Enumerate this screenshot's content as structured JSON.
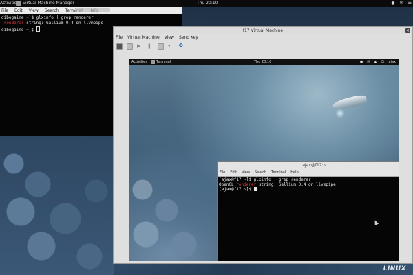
{
  "host": {
    "topbar": {
      "activities": "Activities",
      "app_name": "Virtual Machine Manager",
      "clock": "Thu 20:10",
      "tray": [
        "●",
        "✉",
        "☰"
      ]
    },
    "terminal": {
      "menu": [
        "File",
        "Edit",
        "View",
        "Search",
        "Terminal",
        "Help"
      ],
      "lines": [
        {
          "pre": "dibogaine ~]$ glxinfo | grep renderer",
          "hi": "",
          "post": ""
        },
        {
          "pre": "",
          "hi": " renderer",
          "post": " string: Gallium 0.4 on llvmpipe"
        },
        {
          "pre": "dibogaine ~]$ ",
          "hi": "",
          "post": ""
        }
      ]
    }
  },
  "vm_window": {
    "title": "f17 Virtual Machine",
    "close": "×",
    "menu": [
      "File",
      "Virtual Machine",
      "View",
      "Send Key"
    ]
  },
  "guest": {
    "topbar": {
      "activities": "Activities",
      "app_name": "Terminal",
      "clock": "Thu 20:10",
      "tray": [
        "●",
        "✉",
        "▲",
        "☺",
        "ajax"
      ]
    },
    "terminal": {
      "title": "ajax@f17:~",
      "close": "×",
      "menu": [
        "File",
        "Edit",
        "View",
        "Search",
        "Terminal",
        "Help"
      ],
      "lines": [
        {
          "pre": "[ajax@f17 ~]$ glxinfo | grep renderer",
          "hi": "",
          "post": ""
        },
        {
          "pre": "OpenGL ",
          "hi": "renderer",
          "post": " string: Gallium 0.4 on llvmpipe"
        },
        {
          "pre": "[ajax@f17 ~]$ ",
          "hi": "",
          "post": ""
        }
      ]
    }
  },
  "watermark": {
    "a": "LINUX",
    "b": "."
  }
}
